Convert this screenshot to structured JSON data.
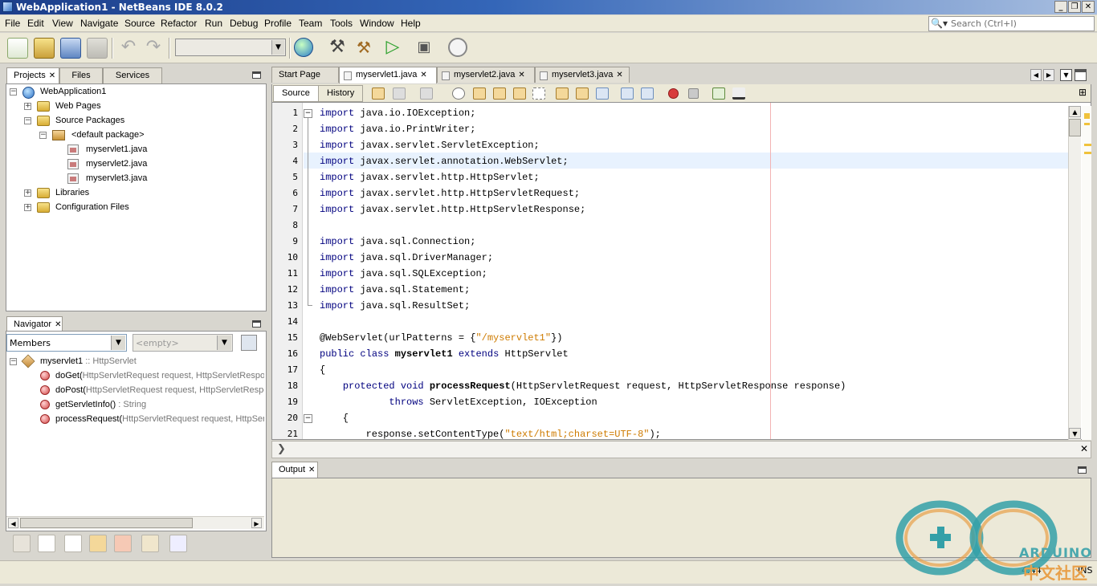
{
  "window": {
    "title": "WebApplication1 - NetBeans IDE 8.0.2"
  },
  "menubar": {
    "items": [
      "File",
      "Edit",
      "View",
      "Navigate",
      "Source",
      "Refactor",
      "Run",
      "Debug",
      "Profile",
      "Team",
      "Tools",
      "Window",
      "Help"
    ]
  },
  "search": {
    "placeholder": "Search (Ctrl+I)"
  },
  "projects_panel": {
    "tabs": [
      {
        "label": "Projects"
      },
      {
        "label": "Files"
      },
      {
        "label": "Services"
      }
    ],
    "tree": [
      {
        "label": "WebApplication1",
        "icon": "project-globe-icon"
      },
      {
        "label": "Web Pages",
        "icon": "folder-icon"
      },
      {
        "label": "Source Packages",
        "icon": "folder-icon"
      },
      {
        "label": "<default package>",
        "icon": "package-icon"
      },
      {
        "label": "myservlet1.java",
        "icon": "java-file-icon"
      },
      {
        "label": "myservlet2.java",
        "icon": "java-file-icon"
      },
      {
        "label": "myservlet3.java",
        "icon": "java-file-icon"
      },
      {
        "label": "Libraries",
        "icon": "folder-icon"
      },
      {
        "label": "Configuration Files",
        "icon": "folder-icon"
      }
    ]
  },
  "navigator": {
    "tab": "Navigator",
    "filter_value": "Members",
    "secondary_value": "<empty>",
    "root": {
      "name": "myservlet1",
      "type": " :: HttpServlet"
    },
    "members": [
      {
        "name": "doGet(",
        "params": "HttpServletRequest request, HttpServletResponse response)"
      },
      {
        "name": "doPost(",
        "params": "HttpServletRequest request, HttpServletResponse response)"
      },
      {
        "name": "getServletInfo()",
        "params": " : String"
      },
      {
        "name": "processRequest(",
        "params": "HttpServletRequest request, HttpServletResponse response)"
      }
    ]
  },
  "editor": {
    "tabs": [
      {
        "label": "Start Page"
      },
      {
        "label": "myservlet1.java"
      },
      {
        "label": "myservlet2.java"
      },
      {
        "label": "myservlet3.java"
      }
    ],
    "source_label": "Source",
    "history_label": "History",
    "lines": [
      {
        "n": "1",
        "text": "import java.io.IOException;"
      },
      {
        "n": "2",
        "text": "import java.io.PrintWriter;"
      },
      {
        "n": "3",
        "text": "import javax.servlet.ServletException;"
      },
      {
        "n": "4",
        "text": "import javax.servlet.annotation.WebServlet;"
      },
      {
        "n": "5",
        "text": "import javax.servlet.http.HttpServlet;"
      },
      {
        "n": "6",
        "text": "import javax.servlet.http.HttpServletRequest;"
      },
      {
        "n": "7",
        "text": "import javax.servlet.http.HttpServletResponse;"
      },
      {
        "n": "8",
        "text": ""
      },
      {
        "n": "9",
        "text": "import java.sql.Connection;"
      },
      {
        "n": "10",
        "text": "import java.sql.DriverManager;"
      },
      {
        "n": "11",
        "text": "import java.sql.SQLException;"
      },
      {
        "n": "12",
        "text": "import java.sql.Statement;"
      },
      {
        "n": "13",
        "text": "import java.sql.ResultSet;"
      },
      {
        "n": "14",
        "text": ""
      },
      {
        "n": "15",
        "text": "@WebServlet(urlPatterns = {\"/myservlet1\"})"
      },
      {
        "n": "16",
        "text": "public class myservlet1 extends HttpServlet"
      },
      {
        "n": "17",
        "text": "{"
      },
      {
        "n": "18",
        "text": "    protected void processRequest(HttpServletRequest request, HttpServletResponse response)"
      },
      {
        "n": "19",
        "text": "            throws ServletException, IOException"
      },
      {
        "n": "20",
        "text": "    {"
      },
      {
        "n": "21",
        "text": "        response.setContentType(\"text/html;charset=UTF-8\");"
      }
    ]
  },
  "output": {
    "tab": "Output"
  },
  "status": {
    "position": "4:44",
    "mode": "INS"
  },
  "watermark": {
    "line1": "ARDUINO",
    "line2": "中文社区"
  },
  "colors": {
    "keyword": "#00007f",
    "string": "#ce7b00",
    "titlebar": "#2a5aa8",
    "highlight": "#e8f2fe"
  }
}
